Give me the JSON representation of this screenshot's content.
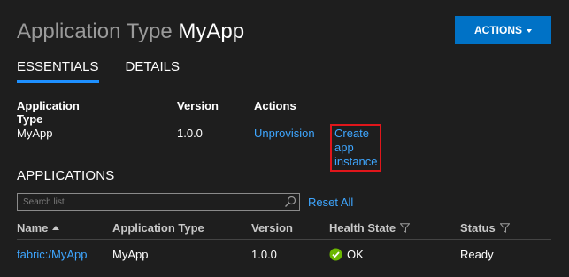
{
  "header": {
    "type_label": "Application Type",
    "app_name": "MyApp",
    "actions_label": "ACTIONS"
  },
  "tabs": [
    {
      "label": "ESSENTIALS",
      "active": true
    },
    {
      "label": "DETAILS",
      "active": false
    }
  ],
  "essentials": {
    "headers": [
      "Application Type",
      "Version",
      "Actions"
    ],
    "app_type": "MyApp",
    "version": "1.0.0",
    "unprovision_label": "Unprovision",
    "create_label": "Create app instance"
  },
  "applications": {
    "heading": "APPLICATIONS",
    "search_placeholder": "Search list",
    "reset_label": "Reset All",
    "columns": [
      "Name",
      "Application Type",
      "Version",
      "Health State",
      "Status"
    ],
    "rows": [
      {
        "name": "fabric:/MyApp",
        "app_type": "MyApp",
        "version": "1.0.0",
        "health": "OK",
        "status": "Ready"
      }
    ]
  },
  "colors": {
    "background": "#1e1e1e",
    "accent": "#0072c6",
    "link": "#3ea6ff",
    "highlight_border": "#e0161b",
    "ok_green": "#6bb700"
  },
  "icons": {
    "sort": "sort-ascending-icon",
    "filter": "filter-icon",
    "search": "search-icon",
    "health_ok": "check-circle-icon"
  }
}
